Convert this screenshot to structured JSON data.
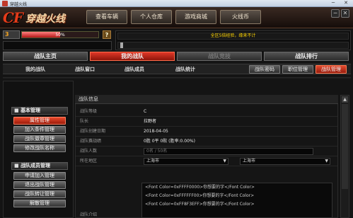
{
  "window": {
    "title": "穿越火线",
    "minimize": "─",
    "close": "✕"
  },
  "header": {
    "logo_latin": "CF",
    "logo_cn": "穿越火线",
    "nav": [
      {
        "label": "查看车辆"
      },
      {
        "label": "个人仓库"
      },
      {
        "label": "游戏商城"
      },
      {
        "label": "火线币"
      }
    ],
    "ctl_minimize": "─",
    "ctl_close": "✕"
  },
  "status": {
    "level": "3",
    "exp_text": "50%",
    "exp_progress": 0.5,
    "help": "?",
    "notice": "全区5倍经验，缘来不计"
  },
  "main_tabs": [
    {
      "label": "战队主页",
      "state": "normal"
    },
    {
      "label": "我的战队",
      "state": "active"
    },
    {
      "label": "战队竞技",
      "state": "dim"
    },
    {
      "label": "战队排行",
      "state": "normal"
    }
  ],
  "sub_tabs": [
    {
      "label": "我的战队"
    },
    {
      "label": "战队窗口"
    },
    {
      "label": "战队成员"
    },
    {
      "label": "战队统计"
    }
  ],
  "sub_buttons": [
    {
      "label": "战队密码",
      "active": false
    },
    {
      "label": "职位管理",
      "active": false
    },
    {
      "label": "战队管理",
      "active": true
    }
  ],
  "left_panel": {
    "sections": [
      {
        "title": "基本管理",
        "items": [
          {
            "label": "属性管理",
            "active": true
          },
          {
            "label": "加入条件管理",
            "active": false
          },
          {
            "label": "战队徽章管理",
            "active": false
          },
          {
            "label": "修改战队名称",
            "active": false
          }
        ]
      },
      {
        "title": "战队成员管理",
        "items": [
          {
            "label": "申请加入管理",
            "active": false
          },
          {
            "label": "退出战队管理",
            "active": false
          },
          {
            "label": "战队转让管理",
            "active": false
          },
          {
            "label": "解散管理",
            "active": false
          }
        ]
      }
    ]
  },
  "content": {
    "title": "战队信息",
    "rows": [
      {
        "label": "战队等级",
        "value": "C"
      },
      {
        "label": "队长",
        "value": "拉野者"
      },
      {
        "label": "战队创建日期",
        "value": "2018-04-05"
      },
      {
        "label": "战队赛战绩",
        "value": "0胜 0平 0败 (胜率:0.00%)"
      },
      {
        "label": "战队人数",
        "value": "0名 / 50名"
      }
    ],
    "region_label": "所在地区",
    "region_province": "上海市",
    "region_city": "上海市",
    "desc_label": "战队介绍",
    "desc_lines": [
      "<Font Color=0xFFFF0000>你想要的字</Font Color>",
      "<Font Color=0xFFFFFF00>你想要的字</Font Color>",
      "<Font Color=0xFF8F3EFF>你想要的字</Font Color>"
    ]
  },
  "colors": {
    "accent_red": "#e03828",
    "notice_yellow": "#ffd400"
  }
}
